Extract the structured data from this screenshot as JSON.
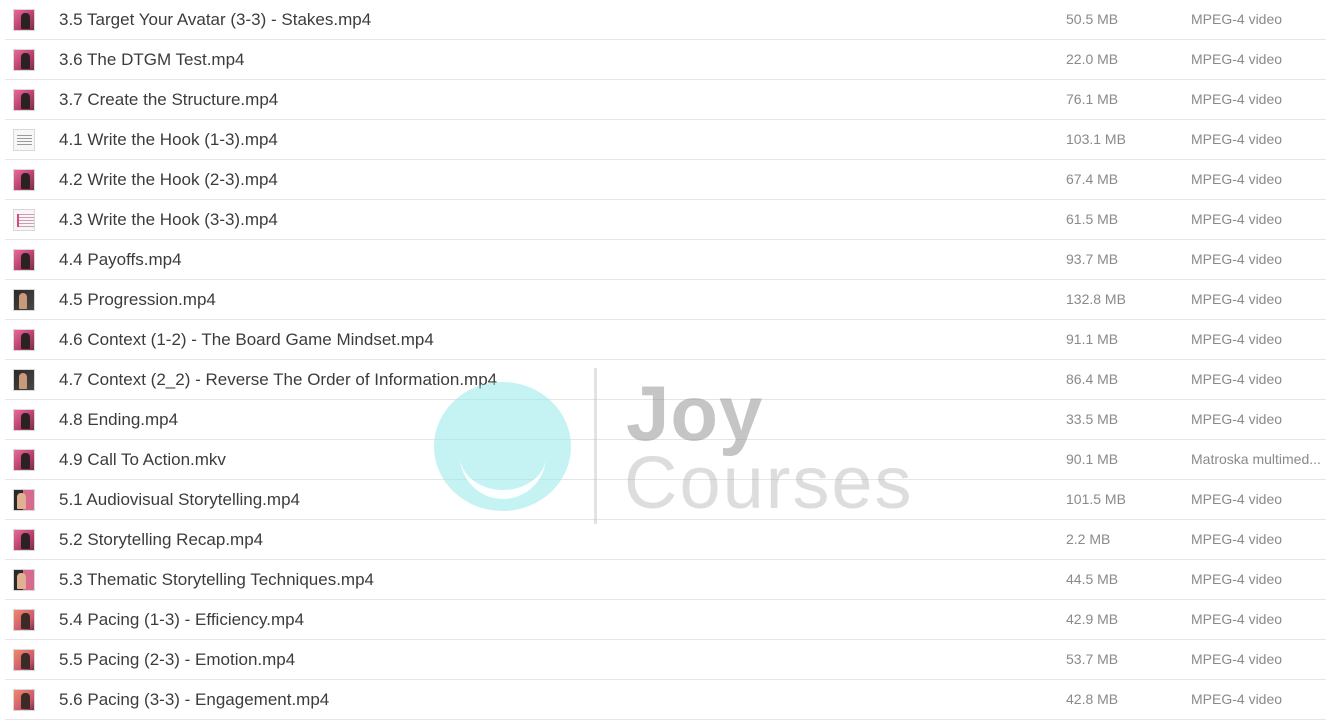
{
  "files": [
    {
      "name": "3.5 Target Your Avatar (3-3) - Stakes.mp4",
      "size": "50.5 MB",
      "type": "MPEG-4 video",
      "thumb": "pink"
    },
    {
      "name": "3.6 The DTGM Test.mp4",
      "size": "22.0 MB",
      "type": "MPEG-4 video",
      "thumb": "pink"
    },
    {
      "name": "3.7 Create the Structure.mp4",
      "size": "76.1 MB",
      "type": "MPEG-4 video",
      "thumb": "pink"
    },
    {
      "name": "4.1 Write the Hook (1-3).mp4",
      "size": "103.1 MB",
      "type": "MPEG-4 video",
      "thumb": "paper"
    },
    {
      "name": "4.2 Write the Hook (2-3).mp4",
      "size": "67.4 MB",
      "type": "MPEG-4 video",
      "thumb": "pink"
    },
    {
      "name": "4.3 Write the Hook (3-3).mp4",
      "size": "61.5 MB",
      "type": "MPEG-4 video",
      "thumb": "paper-pink"
    },
    {
      "name": "4.4 Payoffs.mp4",
      "size": "93.7 MB",
      "type": "MPEG-4 video",
      "thumb": "pink"
    },
    {
      "name": "4.5 Progression.mp4",
      "size": "132.8 MB",
      "type": "MPEG-4 video",
      "thumb": "dark"
    },
    {
      "name": "4.6 Context (1-2) - The Board Game Mindset.mp4",
      "size": "91.1 MB",
      "type": "MPEG-4 video",
      "thumb": "pink"
    },
    {
      "name": "4.7 Context (2_2) - Reverse The Order of Information.mp4",
      "size": "86.4 MB",
      "type": "MPEG-4 video",
      "thumb": "dark"
    },
    {
      "name": "4.8 Ending.mp4",
      "size": "33.5 MB",
      "type": "MPEG-4 video",
      "thumb": "pink"
    },
    {
      "name": "4.9 Call To Action.mkv",
      "size": "90.1 MB",
      "type": "Matroska multimed...",
      "thumb": "pink"
    },
    {
      "name": "5.1 Audiovisual Storytelling.mp4",
      "size": "101.5 MB",
      "type": "MPEG-4 video",
      "thumb": "split"
    },
    {
      "name": "5.2 Storytelling Recap.mp4",
      "size": "2.2 MB",
      "type": "MPEG-4 video",
      "thumb": "pink"
    },
    {
      "name": "5.3 Thematic Storytelling Techniques.mp4",
      "size": "44.5 MB",
      "type": "MPEG-4 video",
      "thumb": "split"
    },
    {
      "name": "5.4 Pacing (1-3) - Efficiency.mp4",
      "size": "42.9 MB",
      "type": "MPEG-4 video",
      "thumb": "warm"
    },
    {
      "name": "5.5 Pacing (2-3) - Emotion.mp4",
      "size": "53.7 MB",
      "type": "MPEG-4 video",
      "thumb": "warm"
    },
    {
      "name": "5.6 Pacing (3-3) - Engagement.mp4",
      "size": "42.8 MB",
      "type": "MPEG-4 video",
      "thumb": "warm"
    }
  ],
  "watermark": {
    "line1": "Joy",
    "line2": "Courses"
  }
}
